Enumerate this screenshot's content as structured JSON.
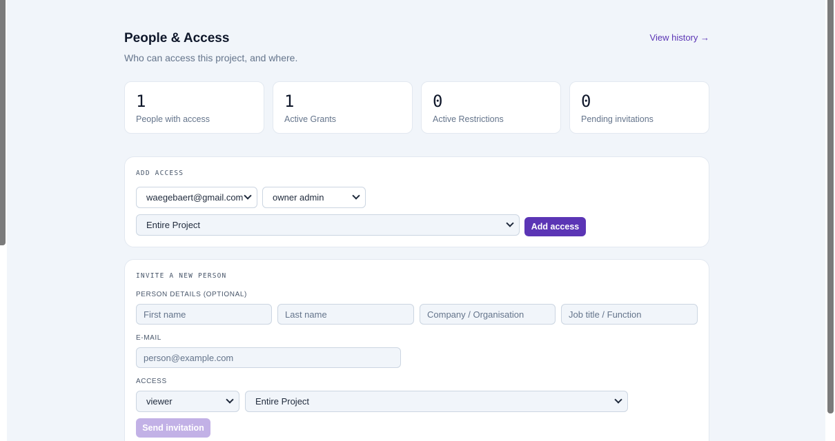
{
  "header": {
    "title": "People & Access",
    "subtitle": "Who can access this project, and where.",
    "history_link": "View history →"
  },
  "stats": [
    {
      "value": "1",
      "label": "People with access"
    },
    {
      "value": "1",
      "label": "Active Grants"
    },
    {
      "value": "0",
      "label": "Active Restrictions"
    },
    {
      "value": "0",
      "label": "Pending invitations"
    }
  ],
  "add_access": {
    "section_label": "ADD ACCESS",
    "person_select": "waegebaert@gmail.com",
    "role_select": "owner admin",
    "scope_select": "Entire Project",
    "submit_label": "Add access"
  },
  "invite": {
    "section_label": "INVITE A NEW PERSON",
    "details_label": "PERSON DETAILS (OPTIONAL)",
    "first_name_placeholder": "First name",
    "last_name_placeholder": "Last name",
    "company_placeholder": "Company / Organisation",
    "job_title_placeholder": "Job title / Function",
    "email_label": "E-MAIL",
    "email_placeholder": "person@example.com",
    "access_label": "ACCESS",
    "role_select": "viewer",
    "scope_select": "Entire Project",
    "submit_label": "Send invitation"
  },
  "colors": {
    "accent": "#5b35b5",
    "accent_disabled": "#c2b1e6",
    "background": "#f1f5fa"
  }
}
